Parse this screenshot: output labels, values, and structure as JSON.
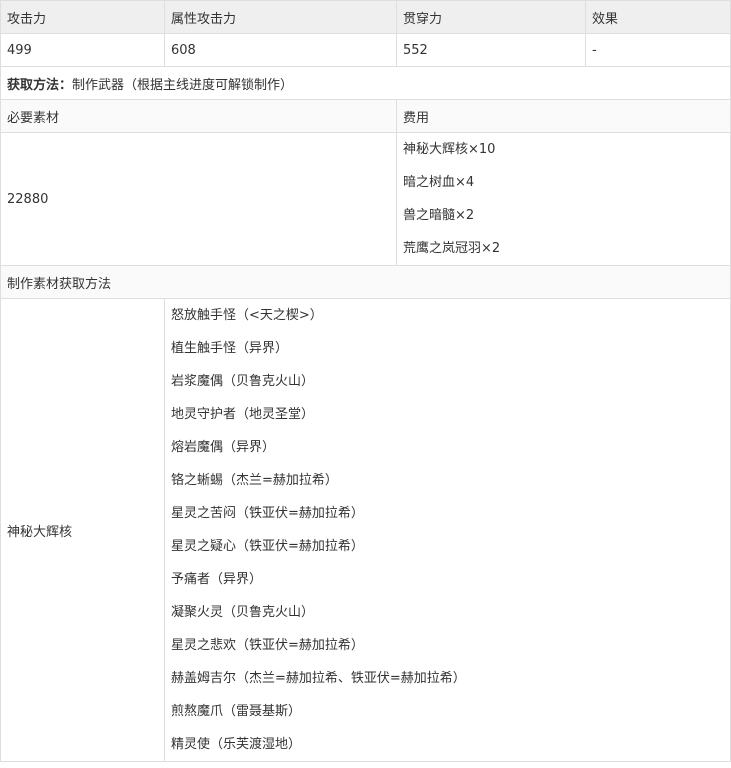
{
  "stats_header": {
    "attack": "攻击力",
    "element_attack": "属性攻击力",
    "pierce": "贯穿力",
    "effect": "效果"
  },
  "stats_values": {
    "attack": "499",
    "element_attack": "608",
    "pierce": "552",
    "effect": "-"
  },
  "method": {
    "label": "获取方法：",
    "text": "制作武器（根据主线进度可解锁制作）"
  },
  "materials_section": {
    "required_label": "必要素材",
    "cost_label": "费用"
  },
  "cost": {
    "value": "22880",
    "materials": [
      "神秘大辉核×10",
      "暗之树血×4",
      "兽之暗髓×2",
      "荒鹰之岚冠羽×2"
    ]
  },
  "source_section": {
    "label": "制作素材获取方法"
  },
  "source": {
    "material": "神秘大辉核",
    "locations": [
      "怒放触手怪（<天之楔>）",
      "植生触手怪（异界）",
      "岩浆魔偶（贝鲁克火山）",
      "地灵守护者（地灵圣堂）",
      "熔岩魔偶（异界）",
      "铬之蜥蜴（杰兰=赫加拉希）",
      "星灵之苦闷（铁亚伏=赫加拉希）",
      "星灵之疑心（铁亚伏=赫加拉希）",
      "予痛者（异界）",
      "凝聚火灵（贝鲁克火山）",
      "星灵之悲欢（铁亚伏=赫加拉希）",
      "赫盖姆吉尔（杰兰=赫加拉希、铁亚伏=赫加拉希）",
      "煎熬魔爪（雷聂基斯）",
      "精灵使（乐芙渡湿地）"
    ]
  }
}
